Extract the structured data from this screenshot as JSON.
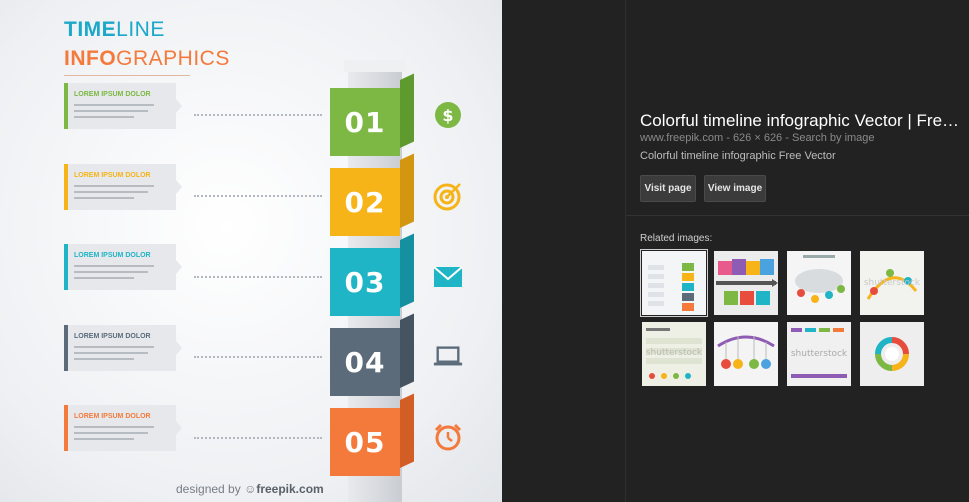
{
  "preview": {
    "title_line1_bold": "TIME",
    "title_line1_rest": "LINE",
    "title_line2_bold": "INFO",
    "title_line2_rest": "GRAPHICS",
    "watermark_prefix": "designed by",
    "watermark_brand": "freepik.com",
    "steps": [
      {
        "number": "01",
        "label": "LOREM IPSUM DOLOR",
        "color": "#7cb843",
        "side": "#5f9a2f",
        "icon": "dollar-icon"
      },
      {
        "number": "02",
        "label": "LOREM IPSUM DOLOR",
        "color": "#f6b418",
        "side": "#d39610",
        "icon": "target-icon"
      },
      {
        "number": "03",
        "label": "LOREM IPSUM DOLOR",
        "color": "#1fb4c6",
        "side": "#1490a1",
        "icon": "envelope-icon"
      },
      {
        "number": "04",
        "label": "LOREM IPSUM DOLOR",
        "color": "#5b6b7a",
        "side": "#465462",
        "icon": "laptop-icon"
      },
      {
        "number": "05",
        "label": "LOREM IPSUM DOLOR",
        "color": "#f47a3c",
        "side": "#d35e25",
        "icon": "alarm-clock-icon"
      }
    ]
  },
  "info": {
    "title": "Colorful timeline infographic Vector | Fre…",
    "domain": "www.freepik.com",
    "dims": "626 × 626",
    "search_by_image": "Search by image",
    "separator": "-",
    "description": "Colorful timeline infographic Free Vector",
    "visit_page": "Visit page",
    "view_image": "View image"
  },
  "related": {
    "label": "Related images:",
    "watermark_text": "shutterstock"
  },
  "colors": {
    "background": "#222222",
    "text_primary": "#ffffff",
    "text_meta": "#8a8a8a",
    "button_bg": "#3b3b3b"
  }
}
